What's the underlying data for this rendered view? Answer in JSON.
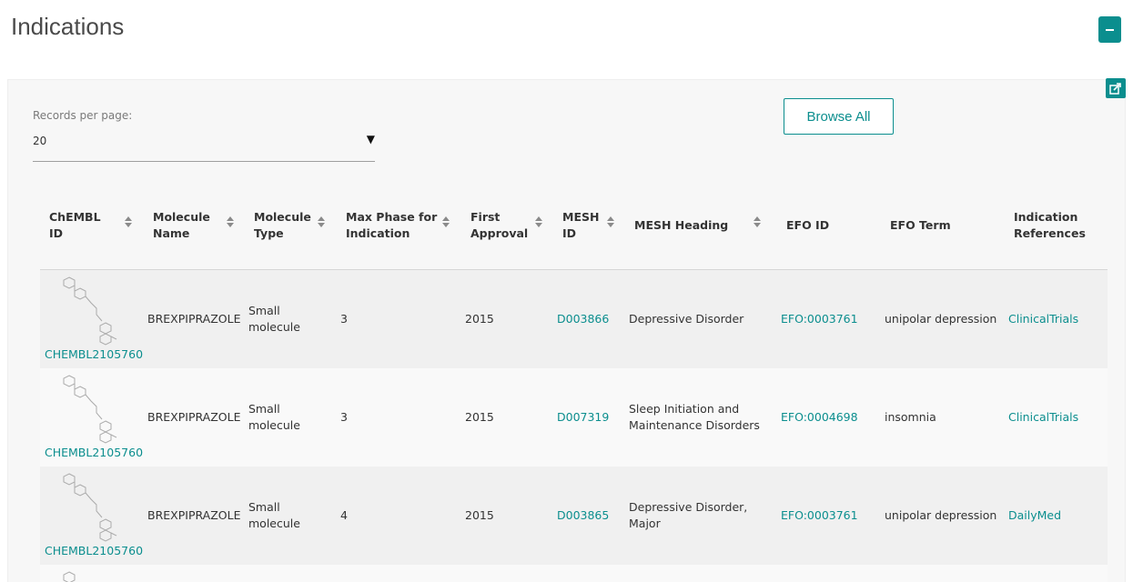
{
  "page": {
    "title": "Indications"
  },
  "controls": {
    "records_per_page_label": "Records per page:",
    "records_per_page_value": "20",
    "caret": "▼",
    "browse_all_label": "Browse All"
  },
  "table": {
    "headers": [
      {
        "label_line1": "ChEMBL",
        "label_line2": "ID",
        "sortable": true
      },
      {
        "label_line1": "Molecule",
        "label_line2": "Name",
        "sortable": true
      },
      {
        "label_line1": "Molecule",
        "label_line2": "Type",
        "sortable": true
      },
      {
        "label_line1": "Max Phase for",
        "label_line2": "Indication",
        "sortable": true
      },
      {
        "label_line1": "First",
        "label_line2": "Approval",
        "sortable": true
      },
      {
        "label_line1": "MESH",
        "label_line2": "ID",
        "sortable": true
      },
      {
        "label_line1": "MESH Heading",
        "label_line2": "",
        "sortable": true
      },
      {
        "label_line1": "EFO ID",
        "label_line2": "",
        "sortable": false
      },
      {
        "label_line1": "EFO Term",
        "label_line2": "",
        "sortable": false
      },
      {
        "label_line1": "Indication",
        "label_line2": "References",
        "sortable": false
      }
    ],
    "rows": [
      {
        "chembl_id": "CHEMBL2105760",
        "molecule_name": "BREXPIPRAZOLE",
        "molecule_type_l1": "Small",
        "molecule_type_l2": "molecule",
        "max_phase": "3",
        "first_approval": "2015",
        "mesh_id": "D003866",
        "mesh_heading_l1": "Depressive Disorder",
        "mesh_heading_l2": "",
        "efo_id": "EFO:0003761",
        "efo_term": "unipolar depression",
        "reference": "ClinicalTrials"
      },
      {
        "chembl_id": "CHEMBL2105760",
        "molecule_name": "BREXPIPRAZOLE",
        "molecule_type_l1": "Small",
        "molecule_type_l2": "molecule",
        "max_phase": "3",
        "first_approval": "2015",
        "mesh_id": "D007319",
        "mesh_heading_l1": "Sleep Initiation and",
        "mesh_heading_l2": "Maintenance Disorders",
        "efo_id": "EFO:0004698",
        "efo_term": "insomnia",
        "reference": "ClinicalTrials"
      },
      {
        "chembl_id": "CHEMBL2105760",
        "molecule_name": "BREXPIPRAZOLE",
        "molecule_type_l1": "Small",
        "molecule_type_l2": "molecule",
        "max_phase": "4",
        "first_approval": "2015",
        "mesh_id": "D003865",
        "mesh_heading_l1": "Depressive Disorder,",
        "mesh_heading_l2": "Major",
        "efo_id": "EFO:0003761",
        "efo_term": "unipolar depression",
        "reference": "DailyMed"
      }
    ]
  },
  "icons": {
    "collapse": "minus-icon",
    "share": "share-icon",
    "sort": "sort-icon",
    "molecule": "molecule-structure-icon"
  },
  "colors": {
    "accent": "#0b8e8e",
    "row_odd": "#f0f0f0",
    "row_even": "#f9f9f9"
  }
}
